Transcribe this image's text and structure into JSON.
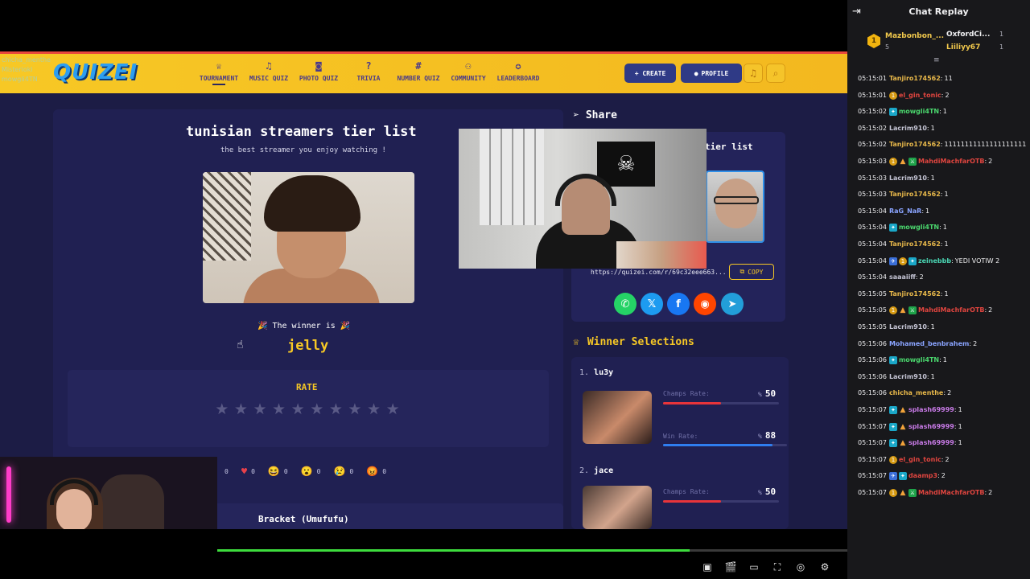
{
  "site": {
    "logo": "QUIZEI",
    "overlay_names": [
      "chicha_menthe",
      "Misterioki",
      "mowgli4TN"
    ],
    "nav": [
      {
        "label": "TOURNAMENT",
        "icon": "trophy-icon",
        "glyph": "♕",
        "active": true
      },
      {
        "label": "MUSIC QUIZ",
        "icon": "music-note-icon",
        "glyph": "♫",
        "active": false
      },
      {
        "label": "PHOTO QUIZ",
        "icon": "camera-icon",
        "glyph": "◙",
        "active": false
      },
      {
        "label": "TRIVIA",
        "icon": "question-icon",
        "glyph": "?",
        "active": false
      },
      {
        "label": "NUMBER QUIZ",
        "icon": "hash-icon",
        "glyph": "#",
        "active": false
      },
      {
        "label": "COMMUNITY",
        "icon": "people-icon",
        "glyph": "⚇",
        "active": false
      },
      {
        "label": "LEADERBOARD",
        "icon": "medal-icon",
        "glyph": "✪",
        "active": false
      }
    ],
    "create_label": "+ CREATE",
    "profile_label": "PROFILE"
  },
  "result": {
    "title": "tunisian streamers tier list",
    "subtitle": "the best streamer you enjoy watching !",
    "winner_label": "🎉 The winner is 🎉",
    "winner_name": "jelly",
    "rate_title": "RATE",
    "stars_total": 10,
    "reactions": [
      {
        "icon": "thumbs-up-icon",
        "glyph": "",
        "count": "0"
      },
      {
        "icon": "heart-icon",
        "glyph": "♥",
        "count": "0",
        "color": "#e8404a"
      },
      {
        "icon": "laugh-icon",
        "glyph": "😆",
        "count": "0"
      },
      {
        "icon": "surprised-icon",
        "glyph": "😮",
        "count": "0"
      },
      {
        "icon": "sad-icon",
        "glyph": "😢",
        "count": "0"
      },
      {
        "icon": "angry-icon",
        "glyph": "😡",
        "count": "0"
      }
    ],
    "bracket_title": "Bracket (Umufufu)"
  },
  "share": {
    "heading": "Share",
    "tier_title_fragment": "tier list",
    "url": "https://quizei.com/r/69c32eee663...",
    "copy_label": "COPY",
    "socials": [
      {
        "name": "whatsapp-icon",
        "glyph": "✆",
        "color": "#25d366"
      },
      {
        "name": "x-icon",
        "glyph": "𝕏",
        "color": "#1d9bf0"
      },
      {
        "name": "facebook-icon",
        "glyph": "f",
        "color": "#1877f2"
      },
      {
        "name": "reddit-icon",
        "glyph": "◉",
        "color": "#ff4500"
      },
      {
        "name": "telegram-icon",
        "glyph": "➤",
        "color": "#229ed9"
      }
    ]
  },
  "winners": {
    "heading": "Winner Selections",
    "items": [
      {
        "rank": "1.",
        "name": "lu3y",
        "champs_label": "Champs Rate:",
        "champs_value": "50",
        "champs_fraction": 0.5,
        "win_label": "Win Rate:",
        "win_value": "88",
        "win_fraction": 0.88
      },
      {
        "rank": "2.",
        "name": "jace",
        "champs_label": "Champs Rate:",
        "champs_value": "50",
        "champs_fraction": 0.5
      }
    ],
    "pct_symbol": "%"
  },
  "player": {
    "progress_fraction": 0.75,
    "controls": [
      "miniplayer-icon",
      "clip-icon",
      "theater-icon",
      "fullscreen-icon",
      "quality-icon",
      "settings-icon"
    ]
  },
  "chat": {
    "title": "Chat Replay",
    "leaderboard": {
      "first_name": "Mazbonbon_...",
      "first_count": "5",
      "second_name": "OxfordCi...",
      "second_count": "1",
      "third_name": "Liiliyy67",
      "third_count": "1"
    },
    "messages": [
      {
        "time": "05:15:01",
        "badges": [],
        "user": "Tanjiro174562",
        "color": "#e8b84a",
        "text": "11"
      },
      {
        "time": "05:15:01",
        "badges": [
          "gold"
        ],
        "user": "el_gin_tonic",
        "color": "#e0453f",
        "text": "2"
      },
      {
        "time": "05:15:02",
        "badges": [
          "sub"
        ],
        "user": "mowgli4TN",
        "color": "#4ad66d",
        "text": "1"
      },
      {
        "time": "05:15:02",
        "badges": [],
        "user": "Lacrim910",
        "color": "#c6c6d6",
        "text": "1"
      },
      {
        "time": "05:15:02",
        "badges": [],
        "user": "Tanjiro174562",
        "color": "#e8b84a",
        "text": "11111111111111111111"
      },
      {
        "time": "05:15:03",
        "badges": [
          "gold",
          "hat",
          "mod"
        ],
        "user": "MahdiMachfarOTB",
        "color": "#e0453f",
        "text": "2"
      },
      {
        "time": "05:15:03",
        "badges": [],
        "user": "Lacrim910",
        "color": "#c6c6d6",
        "text": "1"
      },
      {
        "time": "05:15:03",
        "badges": [],
        "user": "Tanjiro174562",
        "color": "#e8b84a",
        "text": "1"
      },
      {
        "time": "05:15:04",
        "badges": [],
        "user": "RaG_NaR",
        "color": "#8aa4ff",
        "text": "1"
      },
      {
        "time": "05:15:04",
        "badges": [
          "sub"
        ],
        "user": "mowgli4TN",
        "color": "#4ad66d",
        "text": "1"
      },
      {
        "time": "05:15:04",
        "badges": [],
        "user": "Tanjiro174562",
        "color": "#e8b84a",
        "text": "1"
      },
      {
        "time": "05:15:04",
        "badges": [
          "blue",
          "gold",
          "sub"
        ],
        "user": "zeinebbb",
        "color": "#4ad6b4",
        "text": "YEDI VOTIW 2"
      },
      {
        "time": "05:15:04",
        "badges": [],
        "user": "saaaiiff",
        "color": "#c6c6d6",
        "text": "2"
      },
      {
        "time": "05:15:05",
        "badges": [],
        "user": "Tanjiro174562",
        "color": "#e8b84a",
        "text": "1"
      },
      {
        "time": "05:15:05",
        "badges": [
          "gold",
          "hat",
          "mod"
        ],
        "user": "MahdiMachfarOTB",
        "color": "#e0453f",
        "text": "2"
      },
      {
        "time": "05:15:05",
        "badges": [],
        "user": "Lacrim910",
        "color": "#c6c6d6",
        "text": "1"
      },
      {
        "time": "05:15:06",
        "badges": [],
        "user": "Mohamed_benbrahem",
        "color": "#8aa4ff",
        "text": "2"
      },
      {
        "time": "05:15:06",
        "badges": [
          "sub"
        ],
        "user": "mowgli4TN",
        "color": "#4ad66d",
        "text": "1"
      },
      {
        "time": "05:15:06",
        "badges": [],
        "user": "Lacrim910",
        "color": "#c6c6d6",
        "text": "1"
      },
      {
        "time": "05:15:06",
        "badges": [],
        "user": "chicha_menthe",
        "color": "#e8b84a",
        "text": "2"
      },
      {
        "time": "05:15:07",
        "badges": [
          "sub",
          "hat"
        ],
        "user": "splash69999",
        "color": "#c97be8",
        "text": "1"
      },
      {
        "time": "05:15:07",
        "badges": [
          "sub",
          "hat"
        ],
        "user": "splash69999",
        "color": "#c97be8",
        "text": "1"
      },
      {
        "time": "05:15:07",
        "badges": [
          "sub",
          "hat"
        ],
        "user": "splash69999",
        "color": "#c97be8",
        "text": "1"
      },
      {
        "time": "05:15:07",
        "badges": [
          "gold"
        ],
        "user": "el_gin_tonic",
        "color": "#e0453f",
        "text": "2"
      },
      {
        "time": "05:15:07",
        "badges": [
          "blue",
          "sub"
        ],
        "user": "daamp3",
        "color": "#e0453f",
        "text": "2"
      },
      {
        "time": "05:15:07",
        "badges": [
          "gold",
          "hat",
          "mod"
        ],
        "user": "MahdiMachfarOTB",
        "color": "#e0453f",
        "text": "2"
      }
    ]
  }
}
